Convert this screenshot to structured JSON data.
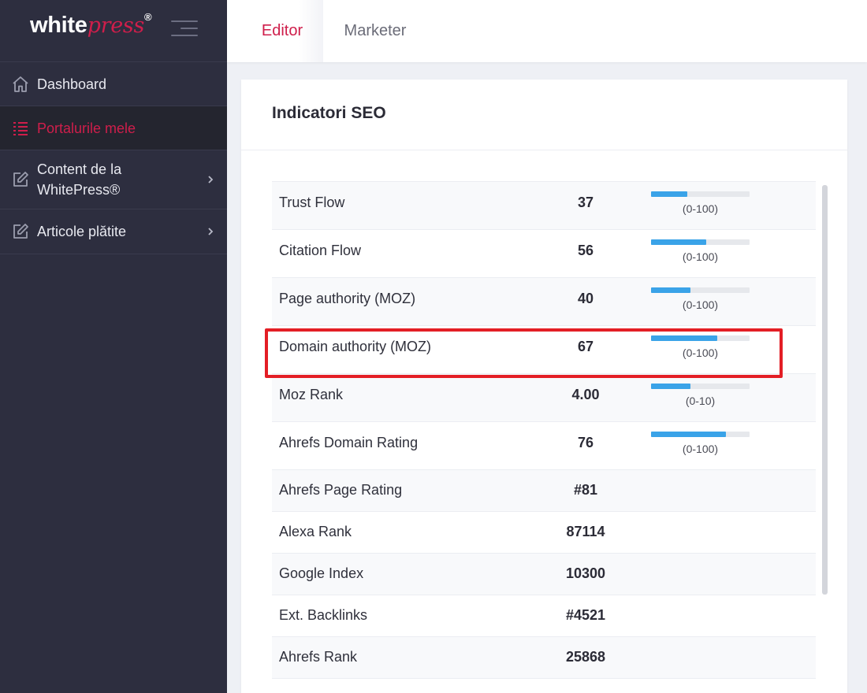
{
  "brand": {
    "name_white": "white",
    "name_press": "press",
    "reg": "®"
  },
  "sidebar": {
    "items": [
      {
        "label": "Dashboard",
        "icon": "home-icon"
      },
      {
        "label": "Portalurile mele",
        "icon": "list-icon",
        "active": true
      },
      {
        "label_line1": "Content de la",
        "label_line2": "WhitePress®",
        "icon": "edit-icon",
        "has_submenu": true
      },
      {
        "label": "Articole plătite",
        "icon": "edit-icon",
        "has_submenu": true
      }
    ]
  },
  "tabs": [
    {
      "label": "Editor",
      "active": true
    },
    {
      "label": "Marketer",
      "active": false
    }
  ],
  "card": {
    "title": "Indicatori SEO",
    "rows": [
      {
        "label": "Trust Flow",
        "value": "37",
        "range": "(0-100)",
        "fill": 0.37
      },
      {
        "label": "Citation Flow",
        "value": "56",
        "range": "(0-100)",
        "fill": 0.56
      },
      {
        "label": "Page authority (MOZ)",
        "value": "40",
        "range": "(0-100)",
        "fill": 0.4
      },
      {
        "label": "Domain authority (MOZ)",
        "value": "67",
        "range": "(0-100)",
        "fill": 0.67
      },
      {
        "label": "Moz Rank",
        "value": "4.00",
        "range": "(0-10)",
        "fill": 0.4
      },
      {
        "label": "Ahrefs Domain Rating",
        "value": "76",
        "range": "(0-100)",
        "fill": 0.76
      },
      {
        "label": "Ahrefs Page Rating",
        "value": "#81"
      },
      {
        "label": "Alexa Rank",
        "value": "87114"
      },
      {
        "label": "Google Index",
        "value": "10300"
      },
      {
        "label": "Ext. Backlinks",
        "value": "#4521"
      },
      {
        "label": "Ahrefs Rank",
        "value": "25868"
      }
    ]
  },
  "colors": {
    "accent": "#cf1e4b",
    "sidebar": "#2d2e3f",
    "bar": "#3aa3e8",
    "highlight": "#e31e25"
  }
}
